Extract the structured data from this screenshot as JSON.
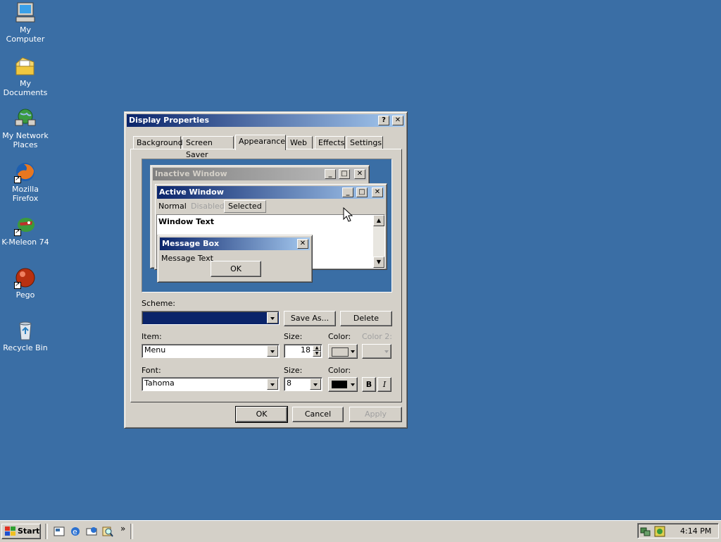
{
  "desktop": {
    "icons": [
      {
        "label": "My Computer",
        "icon": "computer-icon"
      },
      {
        "label": "My Documents",
        "icon": "folder-icon"
      },
      {
        "label": "My Network Places",
        "icon": "network-icon"
      },
      {
        "label": "Mozilla Firefox",
        "icon": "firefox-icon"
      },
      {
        "label": "K-Meleon 74",
        "icon": "kmeleon-icon"
      },
      {
        "label": "Pego",
        "icon": "pego-icon"
      },
      {
        "label": "Recycle Bin",
        "icon": "recycle-bin-icon"
      }
    ]
  },
  "dialog": {
    "title": "Display Properties",
    "help_glyph": "?",
    "close_glyph": "✕",
    "tabs": [
      "Background",
      "Screen Saver",
      "Appearance",
      "Web",
      "Effects",
      "Settings"
    ],
    "selected_tab": "Appearance",
    "preview": {
      "inactive_title": "Inactive Window",
      "active_title": "Active Window",
      "menu_normal": "Normal",
      "menu_disabled": "Disabled",
      "menu_selected": "Selected",
      "window_text": "Window Text",
      "msgbox_title": "Message Box",
      "msgbox_text": "Message Text",
      "msgbox_ok": "OK"
    },
    "scheme_label": "Scheme:",
    "scheme_value": "",
    "save_as": "Save As...",
    "delete": "Delete",
    "item_label": "Item:",
    "item_value": "Menu",
    "item_size_label": "Size:",
    "item_size_value": "18",
    "item_color_label": "Color:",
    "item_color2_label": "Color 2:",
    "font_label": "Font:",
    "font_value": "Tahoma",
    "font_size_label": "Size:",
    "font_size_value": "8",
    "font_color_label": "Color:",
    "bold": "B",
    "italic": "I",
    "ok": "OK",
    "cancel": "Cancel",
    "apply": "Apply"
  },
  "taskbar": {
    "start": "Start",
    "chevron": "»",
    "clock": "4:14 PM"
  },
  "colors": {
    "desktop": "#3a6ea5",
    "active_title_start": "#0a246a",
    "active_title_end": "#a6caf0",
    "face": "#d4d0c8"
  }
}
